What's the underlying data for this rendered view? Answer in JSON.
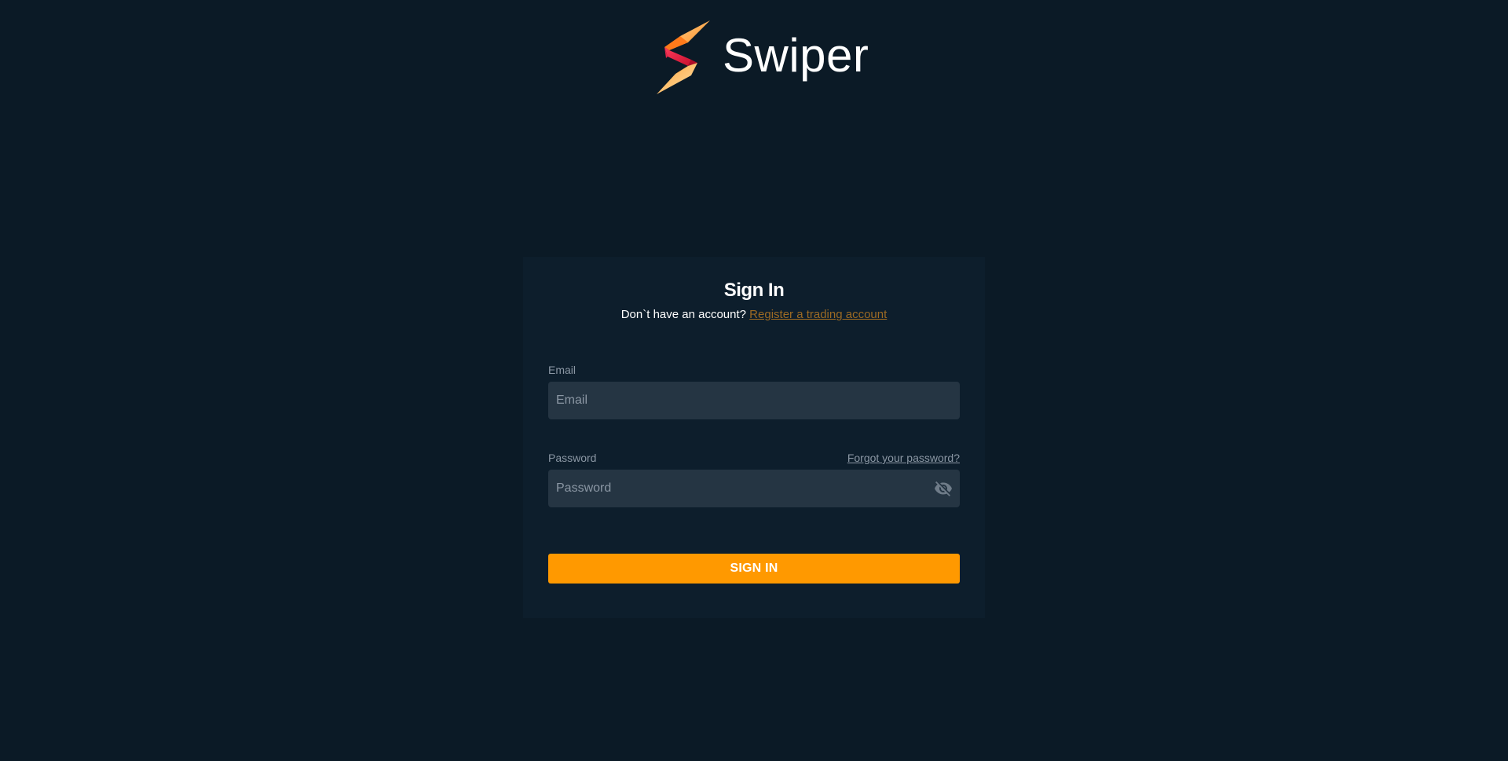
{
  "brand": {
    "name": "Swiper"
  },
  "signin": {
    "title": "Sign In",
    "subtitle_prefix": "Don`t have an account?",
    "register_link": "Register a trading account",
    "email_label": "Email",
    "email_placeholder": "Email",
    "email_value": "",
    "password_label": "Password",
    "password_placeholder": "Password",
    "password_value": "",
    "forgot_link": "Forgot your password?",
    "submit_label": "SIGN IN"
  },
  "colors": {
    "background": "#0b1a26",
    "card": "#0d1e2c",
    "input": "#253543",
    "accent": "#ff9900",
    "link": "#9c6a23",
    "muted": "#8b97a4"
  },
  "icons": {
    "brand_logo": "swiper-bolt-logo",
    "password_toggle": "eye-off-icon"
  }
}
